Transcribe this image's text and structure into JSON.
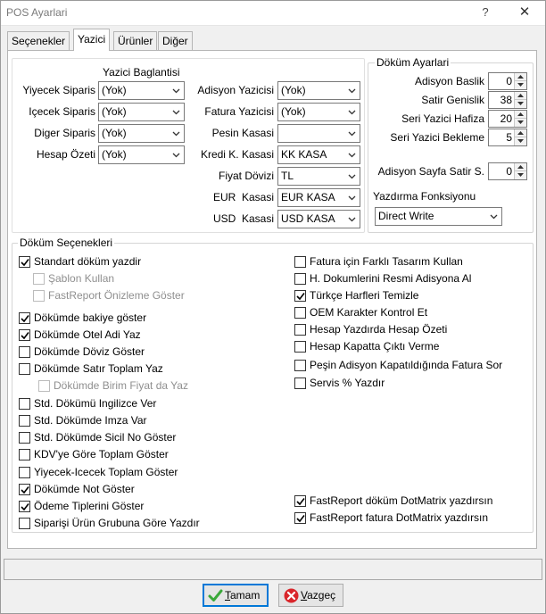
{
  "window": {
    "title": "POS Ayarlari",
    "help_glyph": "?",
    "close_glyph": "✕"
  },
  "tabs": [
    "Seçenekler",
    "Yazici",
    "Ürünler",
    "Diğer"
  ],
  "active_tab": "Yazici",
  "yazici_baglantisi": {
    "title": "Yazici Baglantisi",
    "left": [
      {
        "label": "Yiyecek Siparis",
        "value": "(Yok)"
      },
      {
        "label": "Içecek Siparis",
        "value": "(Yok)"
      },
      {
        "label": "Diger Siparis",
        "value": "(Yok)"
      },
      {
        "label": "Hesap Özeti",
        "value": "(Yok)"
      }
    ],
    "right": [
      {
        "label": "Adisyon Yazicisi",
        "value": "(Yok)"
      },
      {
        "label": "Fatura Yazicisi",
        "value": "(Yok)"
      },
      {
        "label": "Pesin Kasasi",
        "value": ""
      },
      {
        "label": "Kredi K. Kasasi",
        "value": "KK KASA"
      },
      {
        "label": "Fiyat Dövizi",
        "value": "TL"
      },
      {
        "label": "EUR  Kasasi",
        "value": "EUR KASA"
      },
      {
        "label": "USD  Kasasi",
        "value": "USD KASA"
      }
    ]
  },
  "dokum_ayarlari": {
    "title": "Döküm Ayarlari",
    "spins": [
      {
        "label": "Adisyon Baslik",
        "value": "0"
      },
      {
        "label": "Satir Genislik",
        "value": "38"
      },
      {
        "label": "Seri Yazici Hafiza",
        "value": "20"
      },
      {
        "label": "Seri Yazici Bekleme",
        "value": "5"
      },
      {
        "label": "Adisyon Sayfa Satir S.",
        "value": "0"
      }
    ],
    "fonksiyon_label": "Yazdırma Fonksiyonu",
    "fonksiyon_value": "Direct Write"
  },
  "dokum_secenekleri": {
    "title": "Döküm Seçenekleri",
    "left": [
      {
        "label": "Standart döküm yazdir",
        "checked": true,
        "disabled": false
      },
      {
        "label": "Şablon Kullan",
        "checked": false,
        "disabled": true
      },
      {
        "label": "FastReport Önizleme Göster",
        "checked": false,
        "disabled": true
      },
      {
        "label": "Dökümde bakiye göster",
        "checked": true,
        "disabled": false
      },
      {
        "label": "Dökümde Otel Adi Yaz",
        "checked": true,
        "disabled": false
      },
      {
        "label": "Dökümde Döviz Göster",
        "checked": false,
        "disabled": false
      },
      {
        "label": "Dökümde Satır Toplam Yaz",
        "checked": false,
        "disabled": false
      },
      {
        "label": "Dökümde Birim Fiyat da Yaz",
        "checked": false,
        "disabled": true
      },
      {
        "label": "Std. Dökümü Ingilizce Ver",
        "checked": false,
        "disabled": false
      },
      {
        "label": "Std. Dökümde Imza Var",
        "checked": false,
        "disabled": false
      },
      {
        "label": "Std. Dökümde Sicil No Göster",
        "checked": false,
        "disabled": false
      },
      {
        "label": "KDV'ye Göre Toplam Göster",
        "checked": false,
        "disabled": false
      },
      {
        "label": "Yiyecek-Icecek Toplam Göster",
        "checked": false,
        "disabled": false
      },
      {
        "label": "Dökümde Not Göster",
        "checked": true,
        "disabled": false
      },
      {
        "label": "Ödeme Tiplerini Göster",
        "checked": true,
        "disabled": false
      },
      {
        "label": "Siparişi Ürün Grubuna Göre Yazdır",
        "checked": false,
        "disabled": false
      }
    ],
    "right": [
      {
        "label": "Fatura için Farklı Tasarım Kullan",
        "checked": false,
        "disabled": false
      },
      {
        "label": "H. Dokumlerini Resmi Adisyona Al",
        "checked": false,
        "disabled": false
      },
      {
        "label": "Türkçe Harfleri Temizle",
        "checked": true,
        "disabled": false
      },
      {
        "label": "OEM Karakter Kontrol Et",
        "checked": false,
        "disabled": false
      },
      {
        "label": "Hesap Yazdırda Hesap Özeti",
        "checked": false,
        "disabled": false
      },
      {
        "label": "Hesap Kapatta Çıktı Verme",
        "checked": false,
        "disabled": false
      },
      {
        "label": "Peşin Adisyon Kapatıldığında Fatura Sor",
        "checked": false,
        "disabled": false
      },
      {
        "label": "Servis % Yazdır",
        "checked": false,
        "disabled": false
      }
    ],
    "right_bottom": [
      {
        "label": "FastReport döküm DotMatrix yazdırsın",
        "checked": true,
        "disabled": false
      },
      {
        "label": "FastReport fatura DotMatrix yazdırsın",
        "checked": true,
        "disabled": false
      }
    ]
  },
  "buttons": {
    "ok": {
      "hotkey": "T",
      "rest": "amam",
      "icon": "check-icon"
    },
    "cancel": {
      "hotkey": "V",
      "rest": "azgeç",
      "icon": "cancel-icon"
    }
  },
  "colors": {
    "accent": "#0078d7",
    "ok_green": "#3aa83a",
    "cancel_red": "#d9262b"
  }
}
